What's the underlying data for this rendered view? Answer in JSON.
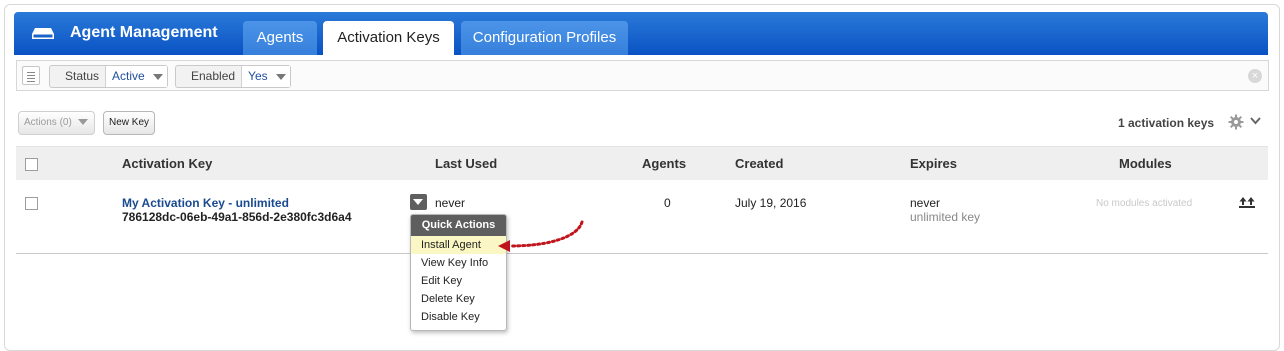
{
  "header": {
    "app_title": "Agent Management",
    "app_icon": "drive-icon",
    "tabs": [
      {
        "label": "Agents",
        "active": false
      },
      {
        "label": "Activation Keys",
        "active": true
      },
      {
        "label": "Configuration Profiles",
        "active": false
      }
    ],
    "accent_color": "#0a52c4"
  },
  "filters": {
    "list_icon": "list-icon",
    "status": {
      "label": "Status",
      "value": "Active"
    },
    "enabled": {
      "label": "Enabled",
      "value": "Yes"
    },
    "clear_icon": "clear-icon"
  },
  "toolbar": {
    "actions_label": "Actions (0)",
    "new_key_label": "New Key",
    "count_text": "1 activation keys",
    "settings_icon": "gear-icon"
  },
  "table": {
    "columns": [
      "Activation Key",
      "Last Used",
      "Agents",
      "Created",
      "Expires",
      "Modules"
    ],
    "rows": [
      {
        "name": "My Activation Key - unlimited",
        "key": "786128dc-06eb-49a1-856d-2e380fc3d6a4",
        "last_used": "never",
        "agents": "0",
        "created": "July 19, 2016",
        "expires": "never",
        "expires_note": "unlimited key",
        "modules": "No modules activated"
      }
    ]
  },
  "quick_actions": {
    "title": "Quick Actions",
    "items": [
      "Install Agent",
      "View Key Info",
      "Edit Key",
      "Delete Key",
      "Disable Key"
    ],
    "highlight_color": "#fbf7c4",
    "pointer_color": "#c0141c"
  }
}
